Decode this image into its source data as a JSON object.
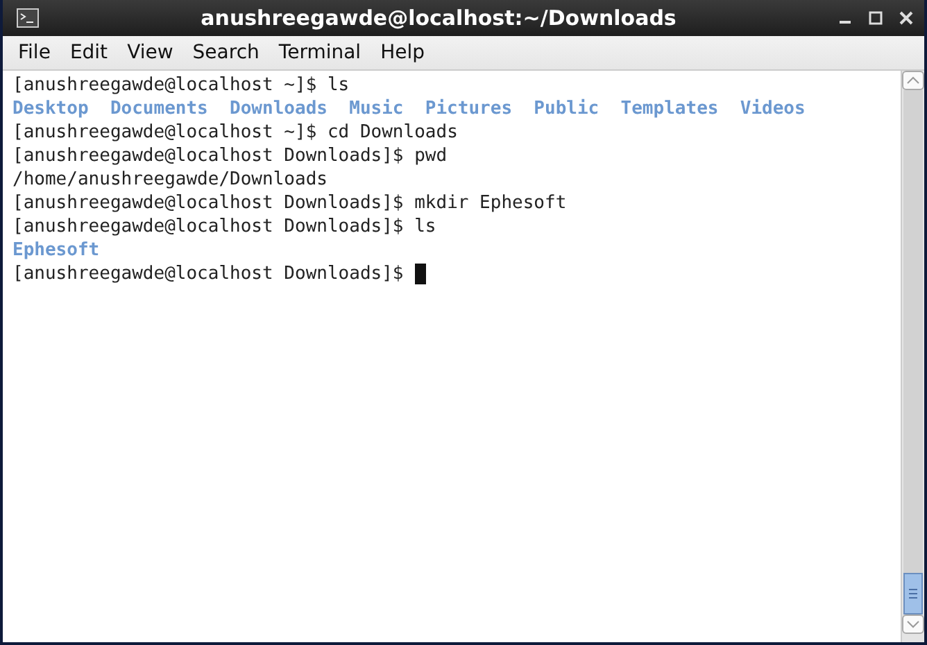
{
  "window": {
    "title": "anushreegawde@localhost:~/Downloads"
  },
  "menu": [
    "File",
    "Edit",
    "View",
    "Search",
    "Terminal",
    "Help"
  ],
  "terminal": {
    "lines": [
      {
        "kind": "text",
        "text": "[anushreegawde@localhost ~]$ ls"
      },
      {
        "kind": "listing",
        "items": [
          "Desktop",
          "Documents",
          "Downloads",
          "Music",
          "Pictures",
          "Public",
          "Templates",
          "Videos"
        ]
      },
      {
        "kind": "text",
        "text": "[anushreegawde@localhost ~]$ cd Downloads"
      },
      {
        "kind": "text",
        "text": "[anushreegawde@localhost Downloads]$ pwd"
      },
      {
        "kind": "text",
        "text": "/home/anushreegawde/Downloads"
      },
      {
        "kind": "text",
        "text": "[anushreegawde@localhost Downloads]$ mkdir Ephesoft"
      },
      {
        "kind": "text",
        "text": "[anushreegawde@localhost Downloads]$ ls"
      },
      {
        "kind": "listing",
        "items": [
          "Ephesoft"
        ]
      },
      {
        "kind": "prompt",
        "text": "[anushreegawde@localhost Downloads]$ "
      }
    ]
  }
}
